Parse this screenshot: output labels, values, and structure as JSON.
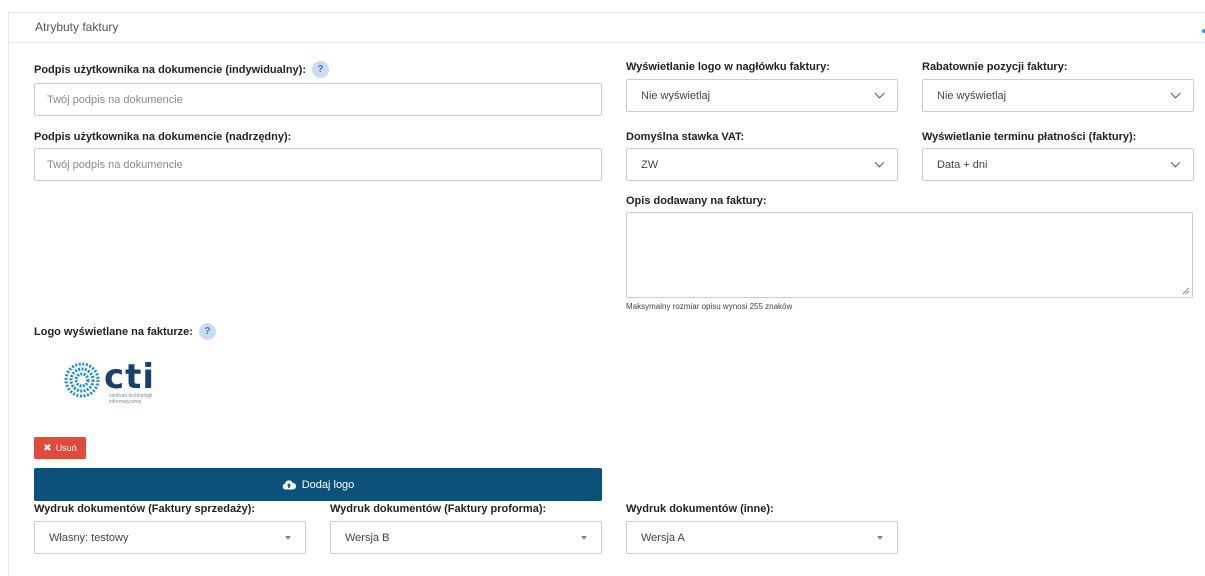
{
  "panel": {
    "title": "Atrybuty faktury"
  },
  "fields": {
    "signature_individual": {
      "label": "Podpis użytkownika na dokumencie (indywidualny):",
      "placeholder": "Twój podpis na dokumencie",
      "value": ""
    },
    "signature_superior": {
      "label": "Podpis użytkownika na dokumencie (nadrzędny):",
      "placeholder": "Twój podpis na dokumencie",
      "value": ""
    },
    "logo_header": {
      "label": "Wyświetlanie logo w nagłówku faktury:",
      "value": "Nie wyświetlaj"
    },
    "discount_items": {
      "label": "Rabatownie pozycji faktury:",
      "value": "Nie wyświetlaj"
    },
    "default_vat": {
      "label": "Domyślna stawka VAT:",
      "value": "ZW"
    },
    "payment_term": {
      "label": "Wyświetlanie terminu płatności (faktury):",
      "value": "Data + dni"
    },
    "description": {
      "label": "Opis dodawany na faktury:",
      "value": "",
      "hint": "Maksymalny rozmiar opisu wynosi 255 znaków"
    },
    "logo": {
      "label": "Logo wyświetlane na fakturze:",
      "brand_text": "cti",
      "brand_subtext": "centrum technologii informatycznej"
    },
    "print_sales": {
      "label": "Wydruk dokumentów (Faktury sprzedaży):",
      "value": "Własny: testowy"
    },
    "print_proforma": {
      "label": "Wydruk dokumentów (Faktury proforma):",
      "value": "Wersja B"
    },
    "print_other": {
      "label": "Wydruk dokumentów (inne):",
      "value": "Wersja A"
    }
  },
  "buttons": {
    "delete": "Usuń",
    "add_logo": "Dodaj logo"
  },
  "help_mark": "?",
  "colors": {
    "primary": "#0c5179",
    "danger": "#e04a3a",
    "help_bg": "#c8dcf5",
    "logo_blue": "#1e8ad4",
    "logo_dark": "#1a3f6b"
  }
}
